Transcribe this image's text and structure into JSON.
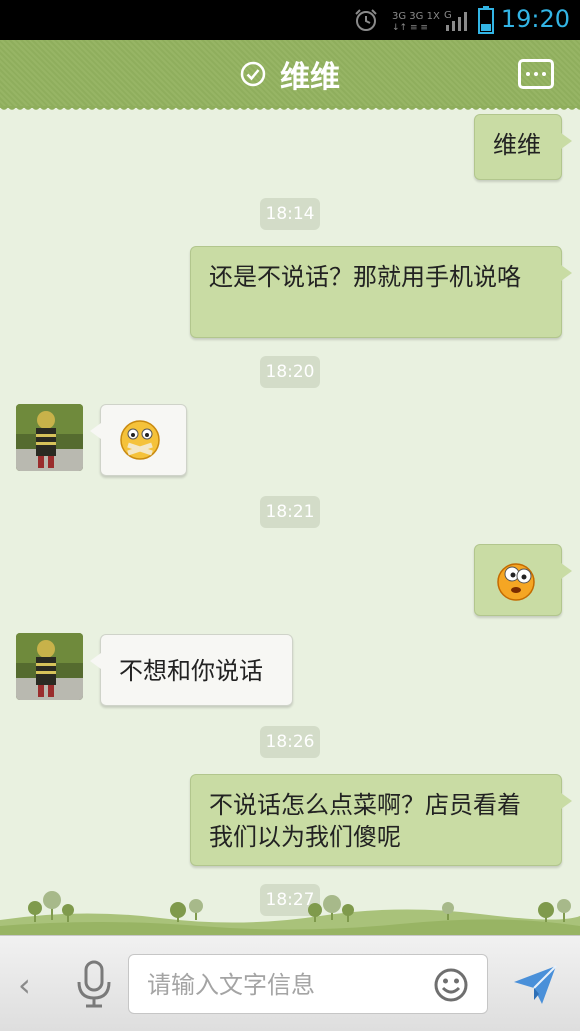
{
  "statusbar": {
    "time": "19:20",
    "network_labels": "3G 3G 1X G",
    "icons": [
      "alarm-icon",
      "signal-icon",
      "battery-icon"
    ]
  },
  "header": {
    "title": "维维",
    "icons": [
      "verified-check-icon",
      "more-menu-icon"
    ]
  },
  "messages": [
    {
      "side": "out",
      "text": "维维"
    },
    {
      "type": "time",
      "text": "18:14"
    },
    {
      "side": "out",
      "text": "还是不说话？那就用手机说咯"
    },
    {
      "type": "time",
      "text": "18:20"
    },
    {
      "side": "in",
      "emoji": "mouth-taped-emoji"
    },
    {
      "type": "time",
      "text": "18:21"
    },
    {
      "side": "out",
      "emoji": "surprised-emoji"
    },
    {
      "side": "in",
      "text": "不想和你说话"
    },
    {
      "type": "time",
      "text": "18:26"
    },
    {
      "side": "out",
      "text": "不说话怎么点菜啊？店员看着我们以为我们傻呢"
    },
    {
      "type": "time",
      "text": "18:27"
    }
  ],
  "composer": {
    "placeholder": "请输入文字信息",
    "icons": [
      "back-chevron-icon",
      "microphone-icon",
      "smiley-icon",
      "send-icon"
    ]
  },
  "colors": {
    "header_green": "#8fae5d",
    "chat_background": "#e9f1e0",
    "outgoing_bubble": "#c9dca4",
    "incoming_bubble": "#f7f7f4",
    "status_blue": "#33b5e5"
  }
}
